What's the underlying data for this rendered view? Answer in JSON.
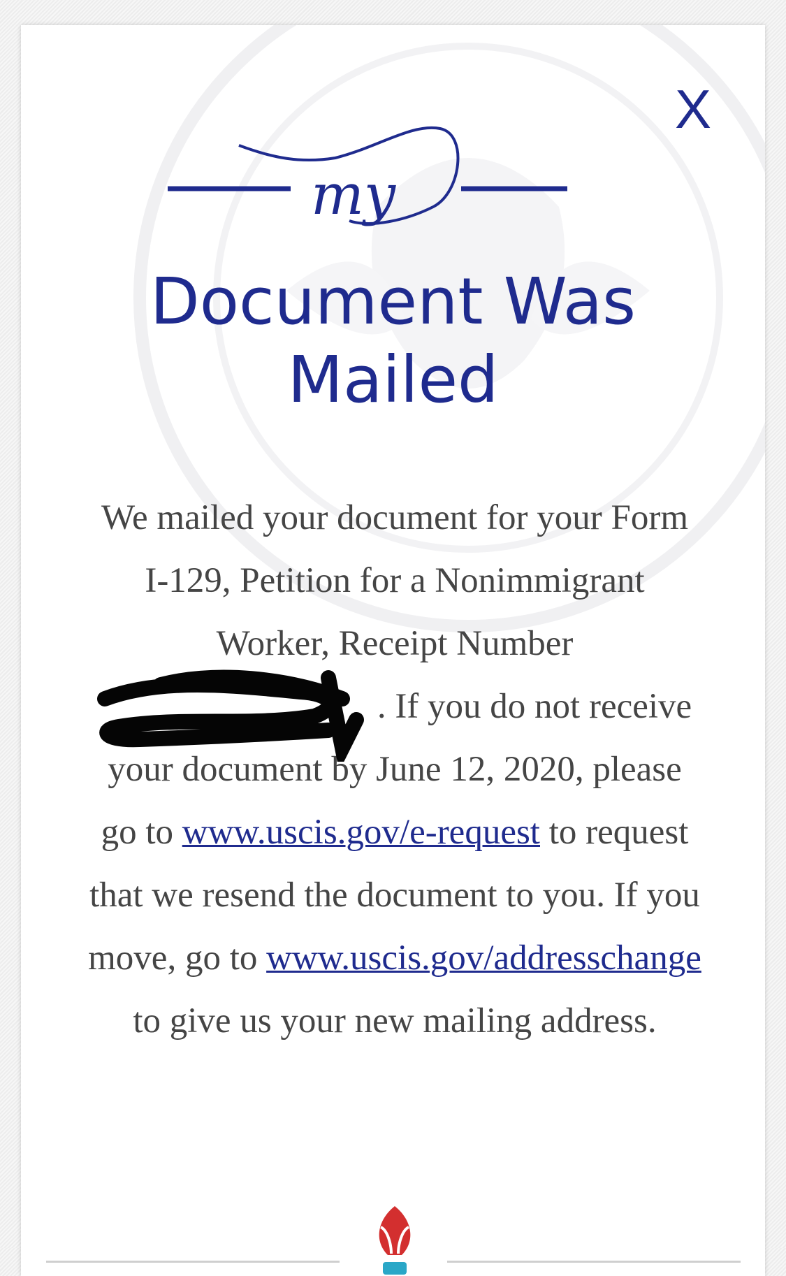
{
  "dialog": {
    "close_label": "X",
    "logo_text": "my",
    "title": "Document Was Mailed",
    "message": {
      "part1": "We mailed your document for your Form I-129, Petition for a Nonimmigrant Worker, Receipt Number",
      "part2": ". If you do not receive your document by June 12, 2020, please go to",
      "link1": "www.uscis.gov/e-request",
      "part3": "to request that we resend the document to you. If you move, go to",
      "link2": "www.uscis.gov/addresschange",
      "part4": "to give us your new mailing address."
    }
  },
  "colors": {
    "brand_blue": "#1f2b8e",
    "text_gray": "#454545",
    "link_blue": "#1f2b8e"
  }
}
